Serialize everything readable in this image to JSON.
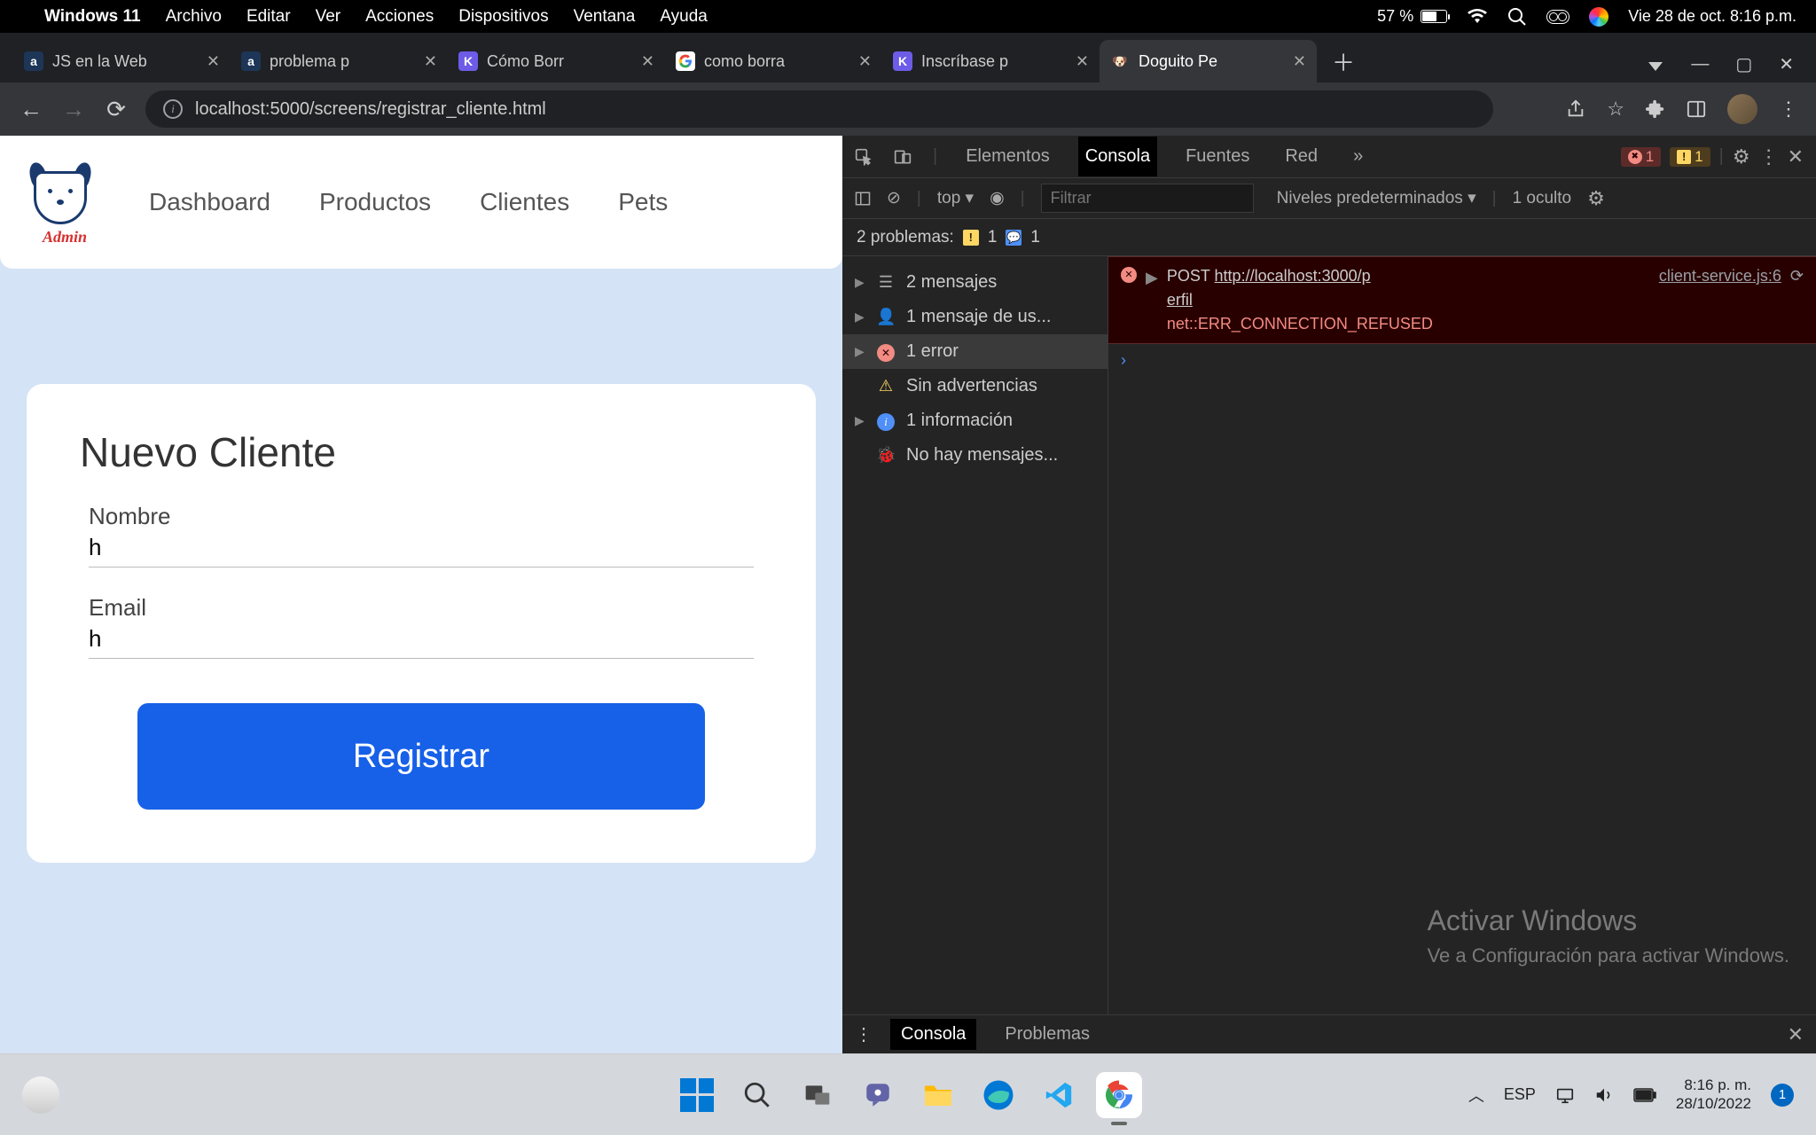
{
  "mac_menu": {
    "app": "Windows 11",
    "items": [
      "Archivo",
      "Editar",
      "Ver",
      "Acciones",
      "Dispositivos",
      "Ventana",
      "Ayuda"
    ],
    "battery_pct": "57 %",
    "datetime": "Vie 28 de oct.  8:16 p.m."
  },
  "browser": {
    "tabs": [
      {
        "title": "JS en la Web",
        "fav": "a"
      },
      {
        "title": "problema p",
        "fav": "a"
      },
      {
        "title": "Cómo Borr",
        "fav": "K"
      },
      {
        "title": "como borra",
        "fav": "G"
      },
      {
        "title": "Inscríbase p",
        "fav": "K"
      },
      {
        "title": "Doguito Pe",
        "fav": "🐶",
        "active": true
      }
    ],
    "url": "localhost:5000/screens/registrar_cliente.html"
  },
  "site": {
    "logo_sub": "Admin",
    "nav": [
      "Dashboard",
      "Productos",
      "Clientes",
      "Pets"
    ],
    "form": {
      "title": "Nuevo Cliente",
      "name_label": "Nombre",
      "name_value": "h",
      "email_label": "Email",
      "email_value": "h",
      "submit": "Registrar"
    }
  },
  "devtools": {
    "tabs": [
      "Elementos",
      "Consola",
      "Fuentes",
      "Red"
    ],
    "active_tab": "Consola",
    "errors_badge": "1",
    "warnings_badge": "1",
    "context": "top",
    "filter_placeholder": "Filtrar",
    "levels": "Niveles predeterminados",
    "hidden": "1 oculto",
    "problems_label": "2 problemas:",
    "problems_warn": "1",
    "problems_info": "1",
    "sidebar": [
      {
        "icon": "msg",
        "label": "2 mensajes",
        "arrow": true
      },
      {
        "icon": "user",
        "label": "1 mensaje de us...",
        "arrow": true
      },
      {
        "icon": "err",
        "label": "1 error",
        "arrow": true,
        "selected": true
      },
      {
        "icon": "warn",
        "label": "Sin advertencias"
      },
      {
        "icon": "info",
        "label": "1 información",
        "arrow": true
      },
      {
        "icon": "bug",
        "label": "No hay mensajes..."
      }
    ],
    "log": {
      "method": "POST",
      "url_part1": "http://localhost:3000/p",
      "url_part2": "erfil",
      "source": "client-service.js:6",
      "error": "net::ERR_CONNECTION_REFUSED"
    },
    "drawer": {
      "tab1": "Consola",
      "tab2": "Problemas"
    }
  },
  "activate": {
    "line1": "Activar Windows",
    "line2": "Ve a Configuración para activar Windows."
  },
  "taskbar": {
    "lang": "ESP",
    "time": "8:16 p. m.",
    "date": "28/10/2022",
    "notif": "1"
  }
}
